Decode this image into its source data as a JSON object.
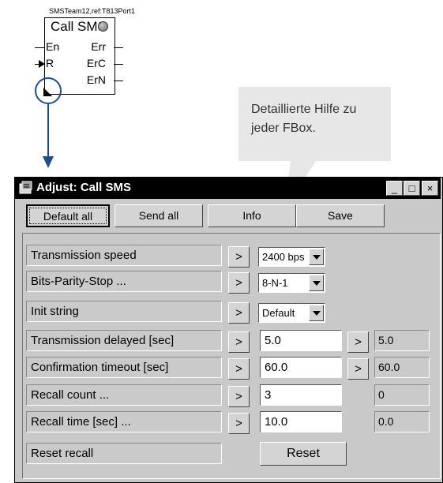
{
  "fbox": {
    "ref": "SMSTeam12,ref:T813Port1",
    "title": "Call SMS",
    "pins_left": [
      "En",
      "R"
    ],
    "pins_right": [
      "Err",
      "ErC",
      "ErN"
    ]
  },
  "callout": {
    "text": "Detaillierte Hilfe zu jeder FBox."
  },
  "window": {
    "title": "Adjust: Call SMS",
    "controls": {
      "minimize": "_",
      "maximize": "□",
      "close": "×"
    }
  },
  "toolbar": {
    "default_all": "Default all",
    "send_all": "Send all",
    "info": "Info",
    "save": "Save"
  },
  "params": [
    {
      "label": "Transmission speed",
      "arrow": ">",
      "value": "2400 bps",
      "kind": "select"
    },
    {
      "label": "Bits-Parity-Stop ...",
      "arrow": ">",
      "value": "8-N-1",
      "kind": "select"
    },
    {
      "label": "Init string",
      "arrow": ">",
      "value": "Default",
      "kind": "select"
    },
    {
      "label": "Transmission delayed [sec]",
      "arrow": ">",
      "value": "5.0",
      "kind": "input",
      "send_arrow": ">",
      "current": "5.0"
    },
    {
      "label": "Confirmation timeout [sec]",
      "arrow": ">",
      "value": "60.0",
      "kind": "input",
      "send_arrow": ">",
      "current": "60.0"
    },
    {
      "label": "Recall count ...",
      "arrow": ">",
      "value": "3",
      "kind": "input",
      "current": "0"
    },
    {
      "label": "Recall time [sec] ...",
      "arrow": ">",
      "value": "10.0",
      "kind": "input",
      "current": "0.0"
    },
    {
      "label": "Reset recall",
      "kind": "button",
      "button_label": "Reset"
    }
  ],
  "colors": {
    "arrow_blue": "#1f4e8c",
    "titlebar": "#000000",
    "window_bg": "#c9c9c9",
    "callout_bg": "#e7e7e7"
  }
}
